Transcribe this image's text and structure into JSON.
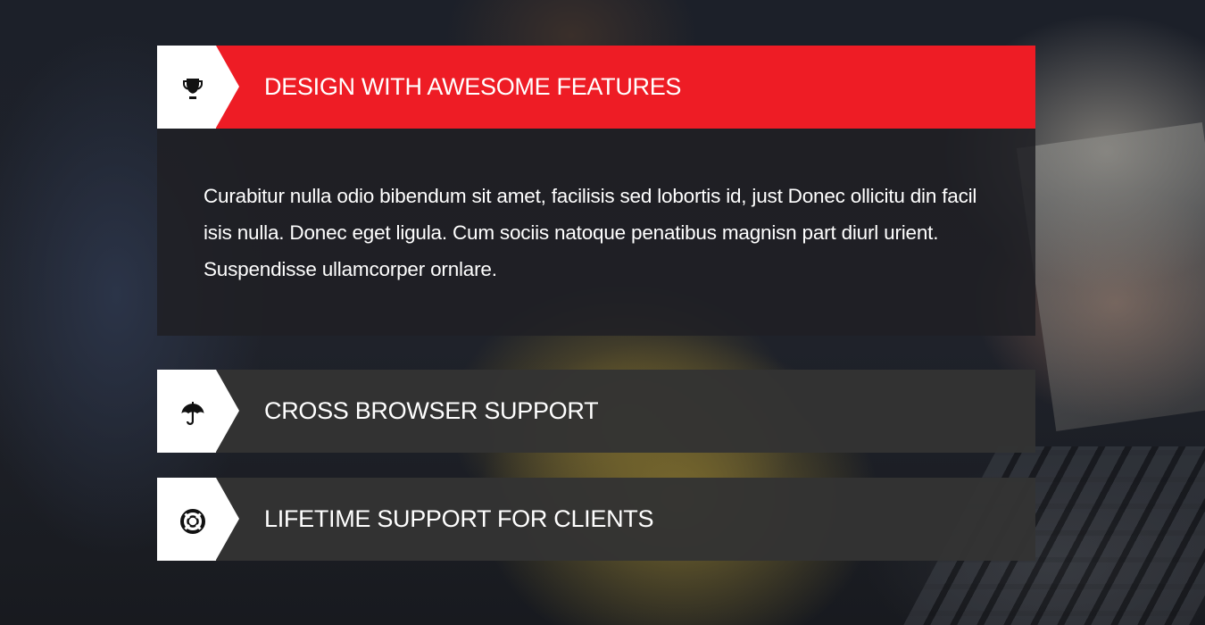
{
  "accordion": {
    "items": [
      {
        "title": "DESIGN WITH AWESOME FEATURES",
        "icon": "trophy-icon",
        "state": "expanded",
        "body": "Curabitur nulla odio bibendum sit amet, facilisis sed lobortis id, just Donec ollicitu din facil isis nulla.  Donec eget ligula. Cum sociis natoque penatibus magnisn part diurl urient. Suspendisse ullamcorper ornlare."
      },
      {
        "title": "CROSS BROWSER SUPPORT",
        "icon": "umbrella-icon",
        "state": "collapsed"
      },
      {
        "title": "LIFETIME SUPPORT FOR CLIENTS",
        "icon": "lifebuoy-icon",
        "state": "collapsed"
      }
    ]
  },
  "colors": {
    "accent": "#ee1c25",
    "collapsed_header": "#333333",
    "panel_background": "#1f2024",
    "icon_box": "#ffffff",
    "text": "#ffffff"
  }
}
